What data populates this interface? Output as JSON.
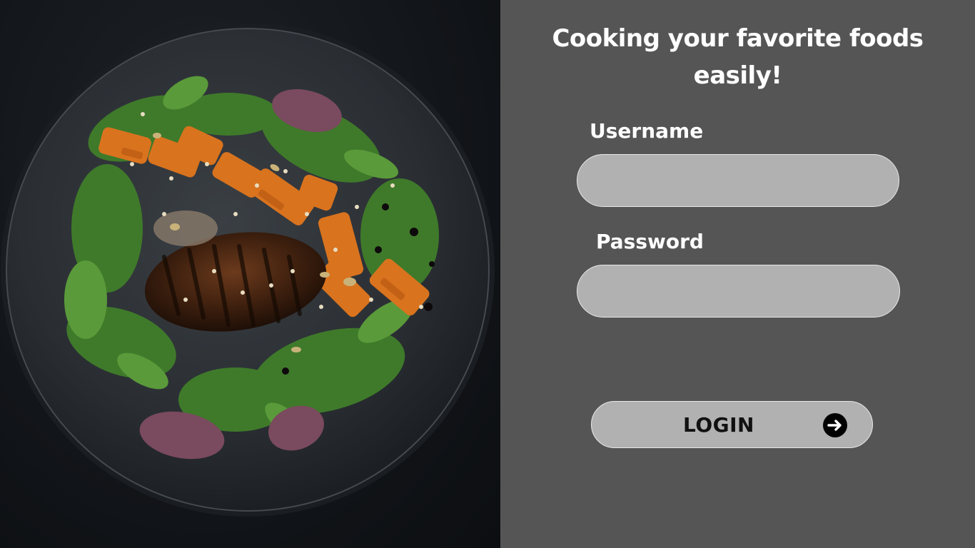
{
  "hero": {
    "image_icon": "salad-plate-photo"
  },
  "form": {
    "headline": "Cooking your favorite foods easily!",
    "username_label": "Username",
    "username_value": "",
    "password_label": "Password",
    "password_value": "",
    "login_label": "LOGIN",
    "login_icon": "arrow-right-circle-icon"
  },
  "colors": {
    "panel_background": "#555555",
    "input_fill": "#b0b1b0",
    "text_light": "#ffffff",
    "text_dark": "#111111"
  }
}
